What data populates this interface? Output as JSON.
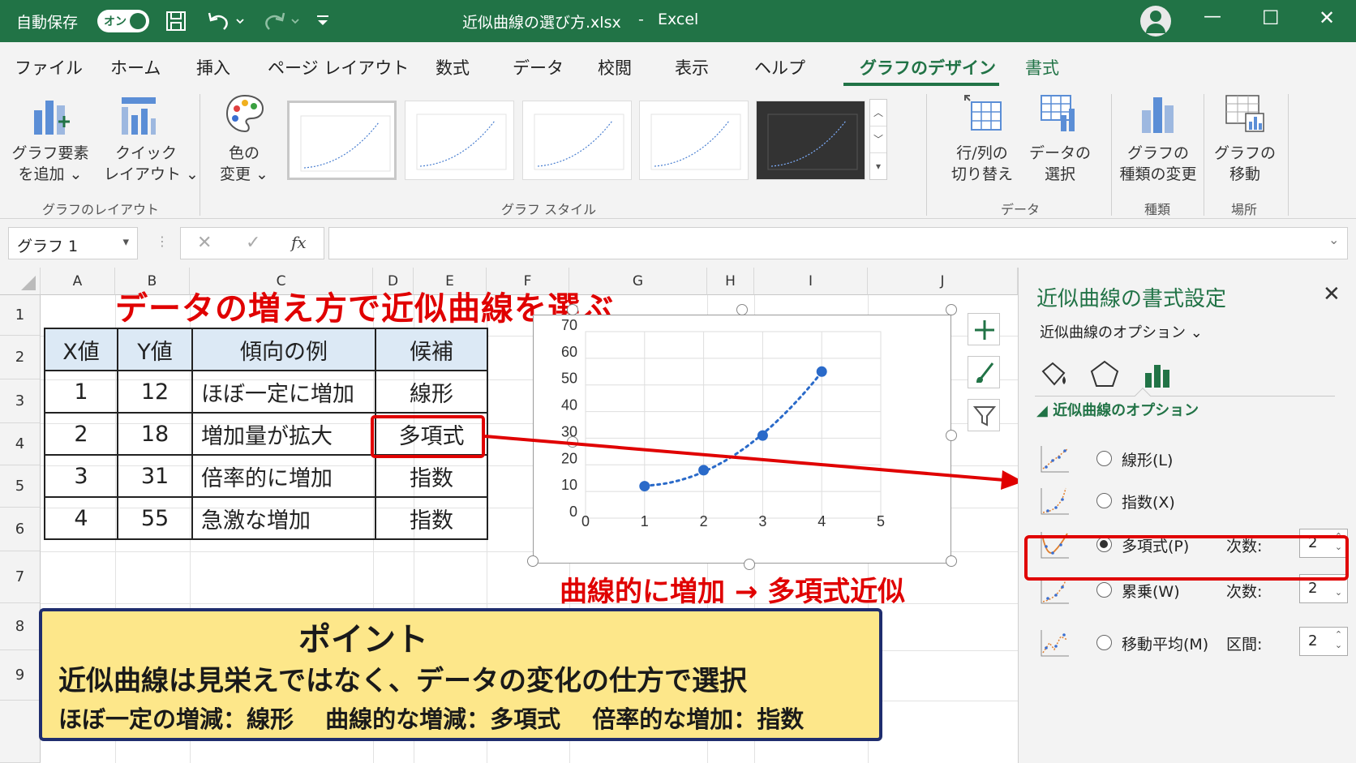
{
  "titlebar": {
    "autosave": "自動保存",
    "autosave_state": "オン",
    "doc_title": "近似曲線の選び方.xlsx",
    "separator": "-",
    "app": "Excel",
    "minimize": "—",
    "maximize": "☐",
    "close": "✕"
  },
  "tabs": [
    "ファイル",
    "ホーム",
    "挿入",
    "ページ レイアウト",
    "数式",
    "データ",
    "校閲",
    "表示",
    "ヘルプ",
    "グラフのデザイン",
    "書式"
  ],
  "ribbon": {
    "add_element_1": "グラフ要素",
    "add_element_2": "を追加 ⌄",
    "quick_layout_1": "クイック",
    "quick_layout_2": "レイアウト ⌄",
    "group_layout": "グラフのレイアウト",
    "color_1": "色の",
    "color_2": "変更 ⌄",
    "group_style": "グラフ スタイル",
    "switch_1": "行/列の",
    "switch_2": "切り替え",
    "select_data_1": "データの",
    "select_data_2": "選択",
    "group_data": "データ",
    "change_type_1": "グラフの",
    "change_type_2": "種類の変更",
    "group_type": "種類",
    "move_1": "グラフの",
    "move_2": "移動",
    "group_location": "場所"
  },
  "formula_bar": {
    "name_box": "グラフ 1",
    "cancel": "✕",
    "enter": "✓",
    "fx": "fx"
  },
  "grid": {
    "columns": [
      "A",
      "B",
      "C",
      "D",
      "E",
      "F",
      "G",
      "H",
      "I",
      "J"
    ],
    "rows": [
      "1",
      "2",
      "3",
      "4",
      "5",
      "6",
      "7",
      "8",
      "9"
    ]
  },
  "sheet": {
    "title": "データの増え方で近似曲線を選ぶ",
    "table_headers": [
      "X値",
      "Y値",
      "傾向の例",
      "候補"
    ],
    "table_rows": [
      [
        "1",
        "12",
        "ほぼ一定に増加",
        "線形"
      ],
      [
        "2",
        "18",
        "増加量が拡大",
        "多項式"
      ],
      [
        "3",
        "31",
        "倍率的に増加",
        "指数"
      ],
      [
        "4",
        "55",
        "急激な増加",
        "指数"
      ]
    ],
    "caption": "曲線的に増加 → 多項式近似",
    "point_title": "ポイント",
    "point_line1": "近似曲線は見栄えではなく、データの変化の仕方で選択",
    "point_line2": "ほぼ一定の増減：線形　 曲線的な増減：多項式　 倍率的な増加：指数",
    "accent_red": "#e00000",
    "point_bg": "#fde78a"
  },
  "chart_data": {
    "type": "scatter",
    "x": [
      1,
      2,
      3,
      4
    ],
    "y": [
      12,
      18,
      31,
      55
    ],
    "trendline": "polynomial",
    "xlim": [
      0,
      5
    ],
    "ylim": [
      0,
      70
    ],
    "xticks": [
      "0",
      "1",
      "2",
      "3",
      "4",
      "5"
    ],
    "yticks": [
      "0",
      "10",
      "20",
      "30",
      "40",
      "50",
      "60",
      "70"
    ],
    "grid": true,
    "point_color": "#2a6ac9"
  },
  "pane": {
    "title": "近似曲線の書式設定",
    "close": "✕",
    "options_dropdown": "近似曲線のオプション ⌄",
    "section": "◢ 近似曲線のオプション",
    "options": [
      {
        "label": "線形(L)",
        "selected": false
      },
      {
        "label": "指数(X)",
        "selected": false
      },
      {
        "label": "多項式(P)",
        "selected": true,
        "extra_label": "次数:",
        "value": "2"
      },
      {
        "label": "累乗(W)",
        "selected": false,
        "extra_label": "次数:",
        "value": "2"
      },
      {
        "label": "移動平均(M)",
        "selected": false,
        "extra_label": "区間:",
        "value": "2"
      }
    ]
  }
}
